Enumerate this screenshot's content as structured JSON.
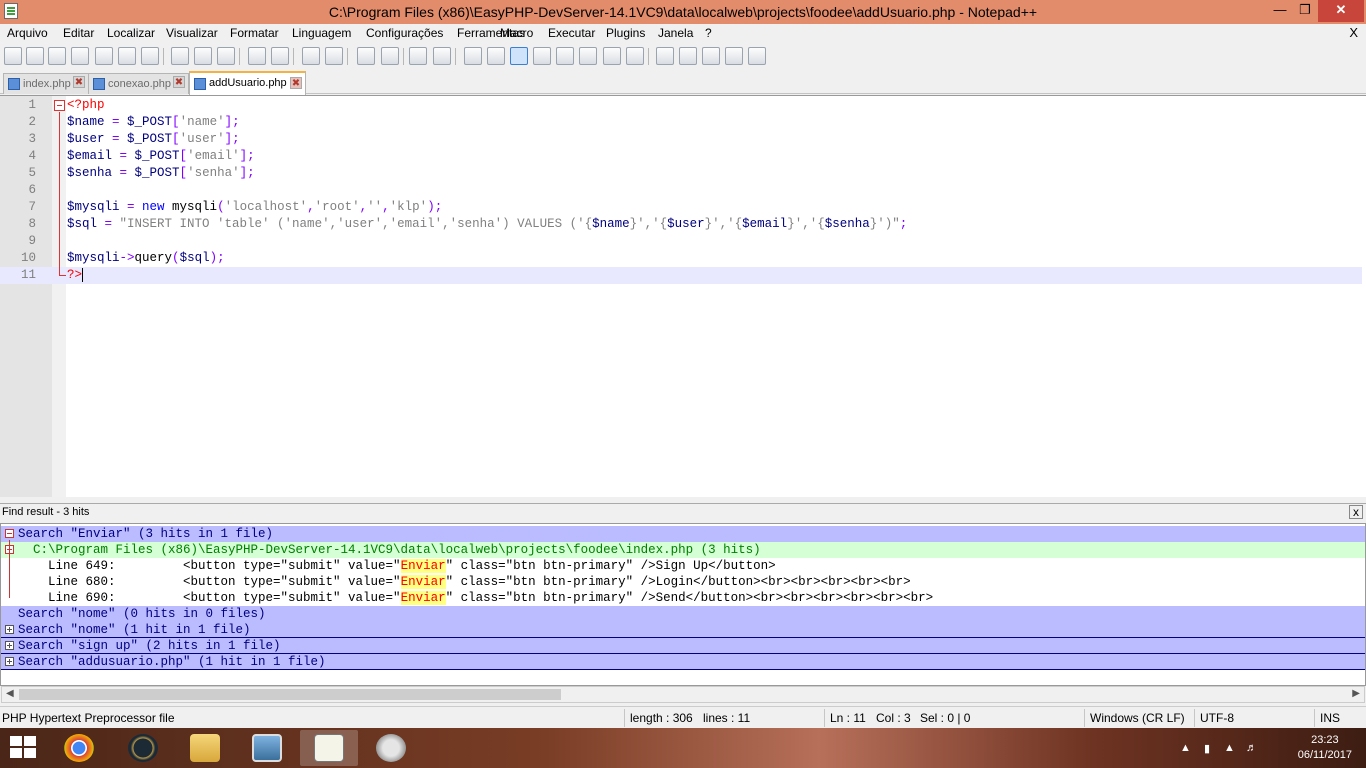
{
  "window": {
    "title": "C:\\Program Files (x86)\\EasyPHP-DevServer-14.1VC9\\data\\localweb\\projects\\foodee\\addUsuario.php - Notepad++",
    "minimize": "—",
    "maximize": "❐",
    "close": "✕"
  },
  "menu": {
    "items": [
      "Arquivo",
      "Editar",
      "Localizar",
      "Visualizar",
      "Formatar",
      "Linguagem",
      "Configurações",
      "Ferramentas",
      "Macro",
      "Executar",
      "Plugins",
      "Janela",
      "?"
    ],
    "close_doc": "X"
  },
  "toolbar": {
    "icons": [
      "new-file-icon",
      "open-file-icon",
      "save-icon",
      "save-all-icon",
      "close-icon",
      "close-all-icon",
      "print-icon",
      "cut-icon",
      "copy-icon",
      "paste-icon",
      "undo-icon",
      "redo-icon",
      "find-icon",
      "replace-icon",
      "zoom-in-icon",
      "zoom-out-icon",
      "sync-vertical-icon",
      "sync-horizontal-icon",
      "word-wrap-icon",
      "show-all-chars-icon",
      "indent-guide-icon",
      "user-language-icon",
      "doc-map-icon",
      "function-list-icon",
      "folder-workspace-icon",
      "monitor-icon",
      "record-macro-icon",
      "stop-macro-icon",
      "play-macro-icon",
      "run-macro-multiple-icon",
      "save-macro-icon"
    ]
  },
  "tabs": [
    {
      "label": "index.php",
      "close": "✖"
    },
    {
      "label": "conexao.php",
      "close": "✖"
    },
    {
      "label": "addUsuario.php",
      "close": "✖"
    }
  ],
  "editor": {
    "lines": [
      {
        "num": "1",
        "tokens": [
          {
            "t": "<?php",
            "c": "tag"
          }
        ]
      },
      {
        "num": "2",
        "tokens": [
          {
            "t": "$name",
            "c": "var"
          },
          {
            "t": " = ",
            "c": "op"
          },
          {
            "t": "$_POST",
            "c": "var"
          },
          {
            "t": "[",
            "c": "op"
          },
          {
            "t": "'name'",
            "c": "str"
          },
          {
            "t": "];",
            "c": "op"
          }
        ]
      },
      {
        "num": "3",
        "tokens": [
          {
            "t": "$user",
            "c": "var"
          },
          {
            "t": " = ",
            "c": "op"
          },
          {
            "t": "$_POST",
            "c": "var"
          },
          {
            "t": "[",
            "c": "op"
          },
          {
            "t": "'user'",
            "c": "str"
          },
          {
            "t": "];",
            "c": "op"
          }
        ]
      },
      {
        "num": "4",
        "tokens": [
          {
            "t": "$email",
            "c": "var"
          },
          {
            "t": " = ",
            "c": "op"
          },
          {
            "t": "$_POST",
            "c": "var"
          },
          {
            "t": "[",
            "c": "op"
          },
          {
            "t": "'email'",
            "c": "str"
          },
          {
            "t": "];",
            "c": "op"
          }
        ]
      },
      {
        "num": "5",
        "tokens": [
          {
            "t": "$senha",
            "c": "var"
          },
          {
            "t": " = ",
            "c": "op"
          },
          {
            "t": "$_POST",
            "c": "var"
          },
          {
            "t": "[",
            "c": "op"
          },
          {
            "t": "'senha'",
            "c": "str"
          },
          {
            "t": "];",
            "c": "op"
          }
        ]
      },
      {
        "num": "6",
        "tokens": []
      },
      {
        "num": "7",
        "tokens": [
          {
            "t": "$mysqli",
            "c": "var"
          },
          {
            "t": " = ",
            "c": "op"
          },
          {
            "t": "new",
            "c": "kw"
          },
          {
            "t": " mysqli",
            "c": "plain"
          },
          {
            "t": "(",
            "c": "op"
          },
          {
            "t": "'localhost'",
            "c": "str"
          },
          {
            "t": ",",
            "c": "op"
          },
          {
            "t": "'root'",
            "c": "str"
          },
          {
            "t": ",",
            "c": "op"
          },
          {
            "t": "''",
            "c": "str"
          },
          {
            "t": ",",
            "c": "op"
          },
          {
            "t": "'klp'",
            "c": "str"
          },
          {
            "t": ");",
            "c": "op"
          }
        ]
      },
      {
        "num": "8",
        "tokens": [
          {
            "t": "$sql",
            "c": "var"
          },
          {
            "t": " = ",
            "c": "op"
          },
          {
            "t": "\"INSERT INTO 'table' ('name','user','email','senha') VALUES ('{",
            "c": "str"
          },
          {
            "t": "$name",
            "c": "var"
          },
          {
            "t": "}','{",
            "c": "str"
          },
          {
            "t": "$user",
            "c": "var"
          },
          {
            "t": "}','{",
            "c": "str"
          },
          {
            "t": "$email",
            "c": "var"
          },
          {
            "t": "}','{",
            "c": "str"
          },
          {
            "t": "$senha",
            "c": "var"
          },
          {
            "t": "}')\"",
            "c": "str"
          },
          {
            "t": ";",
            "c": "op"
          }
        ]
      },
      {
        "num": "9",
        "tokens": []
      },
      {
        "num": "10",
        "tokens": [
          {
            "t": "$mysqli",
            "c": "var"
          },
          {
            "t": "->",
            "c": "op"
          },
          {
            "t": "query",
            "c": "plain"
          },
          {
            "t": "(",
            "c": "op"
          },
          {
            "t": "$sql",
            "c": "var"
          },
          {
            "t": ");",
            "c": "op"
          }
        ]
      },
      {
        "num": "11",
        "tokens": [
          {
            "t": "?>",
            "c": "tag"
          }
        ]
      }
    ],
    "current_line": 11
  },
  "find": {
    "header": "Find result - 3 hits",
    "close": "x",
    "rows": [
      {
        "kind": "search",
        "expanded": true,
        "text": "Search \"Enviar\" (3 hits in 1 file)"
      },
      {
        "kind": "file",
        "expanded": true,
        "text": "  C:\\Program Files (x86)\\EasyPHP-DevServer-14.1VC9\\data\\localweb\\projects\\foodee\\index.php (3 hits)"
      },
      {
        "kind": "line",
        "pre": "    Line 649:         <button type=\"submit\" value=\"",
        "hit": "Enviar",
        "post": "\" class=\"btn btn-primary\" />Sign Up</button>"
      },
      {
        "kind": "line",
        "pre": "    Line 680:         <button type=\"submit\" value=\"",
        "hit": "Enviar",
        "post": "\" class=\"btn btn-primary\" />Login</button><br><br><br><br><br>"
      },
      {
        "kind": "line",
        "pre": "    Line 690:         <button type=\"submit\" value=\"",
        "hit": "Enviar",
        "post": "\" class=\"btn btn-primary\" />Send</button><br><br><br><br><br><br>"
      },
      {
        "kind": "search",
        "expanded": null,
        "text": "Search \"nome\" (0 hits in 0 files)"
      },
      {
        "kind": "search",
        "expanded": false,
        "text": "Search \"nome\" (1 hit in 1 file)"
      },
      {
        "kind": "search",
        "expanded": false,
        "text": "Search \"sign up\" (2 hits in 1 file)"
      },
      {
        "kind": "search",
        "expanded": false,
        "text": "Search \"addusuario.php\" (1 hit in 1 file)"
      }
    ]
  },
  "status": {
    "file_type": "PHP Hypertext Preprocessor file",
    "length": "length : 306",
    "lines": "lines : 11",
    "ln": "Ln : 11",
    "col": "Col : 3",
    "sel": "Sel : 0 | 0",
    "eol": "Windows (CR LF)",
    "encoding": "UTF-8",
    "mode": "INS"
  },
  "taskbar": {
    "apps": [
      "chrome-icon",
      "league-of-legends-icon",
      "file-explorer-icon",
      "photo-viewer-icon",
      "notepad-plus-plus-icon",
      "speaker-app-icon"
    ],
    "time": "23:23",
    "date": "06/11/2017"
  }
}
